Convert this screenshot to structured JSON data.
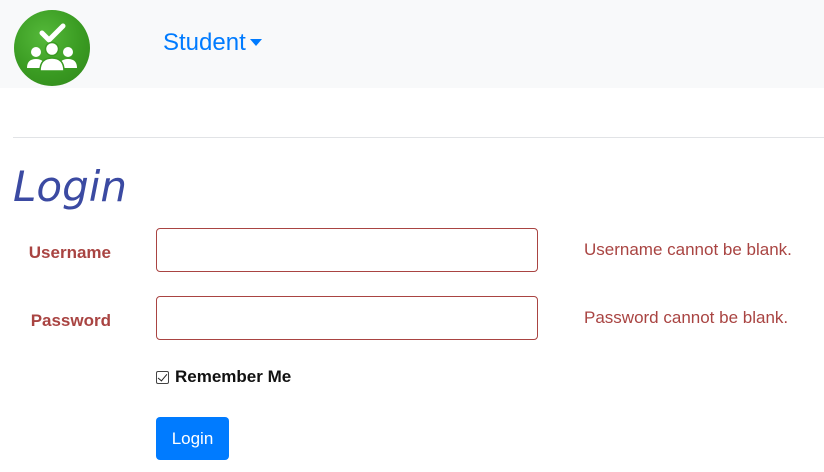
{
  "navbar": {
    "logo_icon": "group-check-icon",
    "dropdown_label": "Student"
  },
  "form": {
    "title": "Login",
    "username": {
      "label": "Username",
      "value": "",
      "error": "Username cannot be blank."
    },
    "password": {
      "label": "Password",
      "value": "",
      "error": "Password cannot be blank."
    },
    "remember_me": {
      "label": "Remember Me",
      "checked": true
    },
    "submit_label": "Login"
  },
  "colors": {
    "brand_blue": "#007bff",
    "error_red": "#a94442",
    "title_blue": "#3b4aa2",
    "logo_green": "#3a9b22"
  }
}
